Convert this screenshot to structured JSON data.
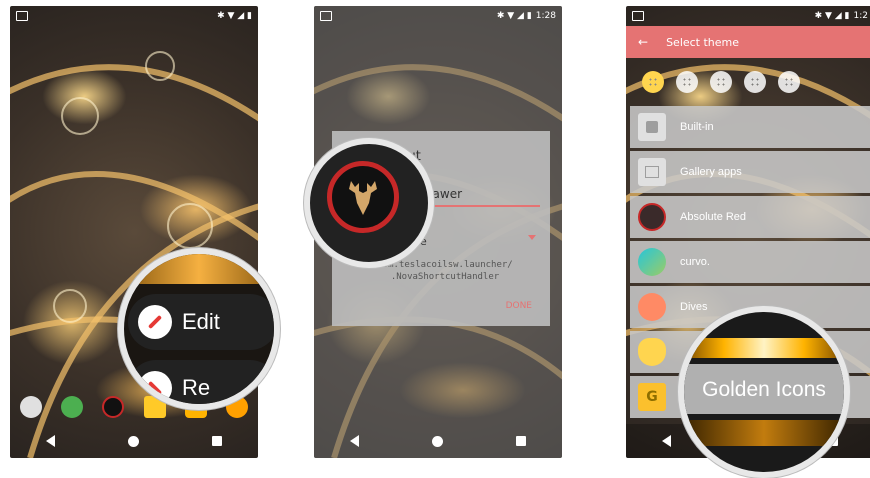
{
  "phone1": {
    "status_bar_icons": [
      "bluetooth-icon",
      "wifi-icon",
      "signal-icon",
      "battery-icon"
    ],
    "popup_menu": {
      "edit_label": "Edit",
      "second_label_partial": "Re"
    },
    "dock_icons": [
      "messages-icon",
      "drive-icon",
      "deer-icon",
      "play-store-icon",
      "google-play-icon",
      "settings-icon"
    ]
  },
  "phone2": {
    "status_time": "1:28",
    "dialog": {
      "title_partial": "ortcut",
      "field_value_partial": "drawer",
      "dropdown_partial": "e",
      "package_line1": "com.teslacoilsw.launcher/",
      "package_line2": ".NovaShortcutHandler",
      "done_label": "DONE"
    }
  },
  "phone3": {
    "status_time": "1:2",
    "appbar_title": "Select theme",
    "rows": [
      {
        "label": "Built-in",
        "icon": "android-icon",
        "color": "#e0e0e0"
      },
      {
        "label": "Gallery apps",
        "icon": "gallery-icon",
        "color": "#e0e0e0"
      },
      {
        "label": "Absolute Red",
        "icon": "absolute-red-icon",
        "color": "#3a2a2a"
      },
      {
        "label": "curvo.",
        "icon": "curvo-icon",
        "color": "#26c6da"
      },
      {
        "label": "Dives",
        "icon": "dives-icon",
        "color": "#ff8a65"
      }
    ],
    "magnifier_label": "Golden Icons",
    "accent_color": "#e57373"
  }
}
